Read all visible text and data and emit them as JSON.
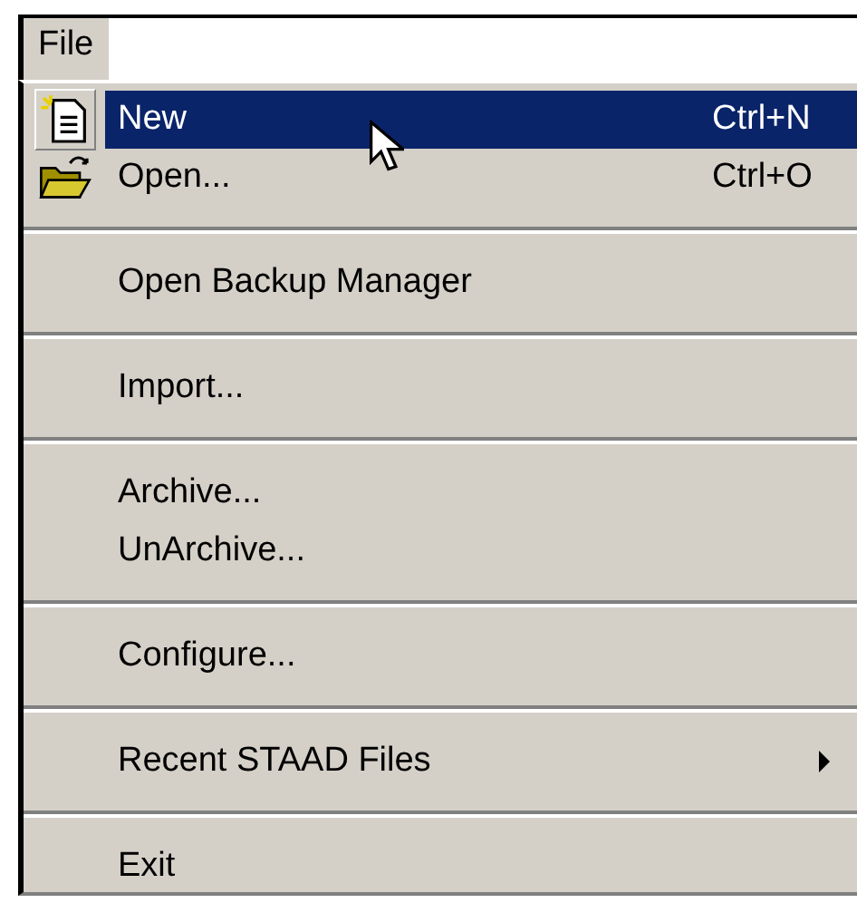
{
  "menu_bar": {
    "title": "File"
  },
  "menu": [
    {
      "kind": "item",
      "label": "New",
      "shortcut": "Ctrl+N",
      "selected": true
    },
    {
      "kind": "item",
      "label": "Open...",
      "shortcut": "Ctrl+O",
      "selected": false
    },
    {
      "kind": "separator"
    },
    {
      "kind": "item",
      "label": "Open Backup Manager",
      "selected": false
    },
    {
      "kind": "separator"
    },
    {
      "kind": "item",
      "label": "Import...",
      "selected": false
    },
    {
      "kind": "separator"
    },
    {
      "kind": "item",
      "label": "Archive...",
      "selected": false
    },
    {
      "kind": "item",
      "label": "UnArchive...",
      "selected": false
    },
    {
      "kind": "separator"
    },
    {
      "kind": "item",
      "label": "Configure...",
      "selected": false
    },
    {
      "kind": "separator"
    },
    {
      "kind": "item",
      "label": "Recent STAAD Files",
      "submenu": true,
      "selected": false
    },
    {
      "kind": "separator"
    },
    {
      "kind": "item",
      "label": "Exit",
      "selected": false
    }
  ]
}
